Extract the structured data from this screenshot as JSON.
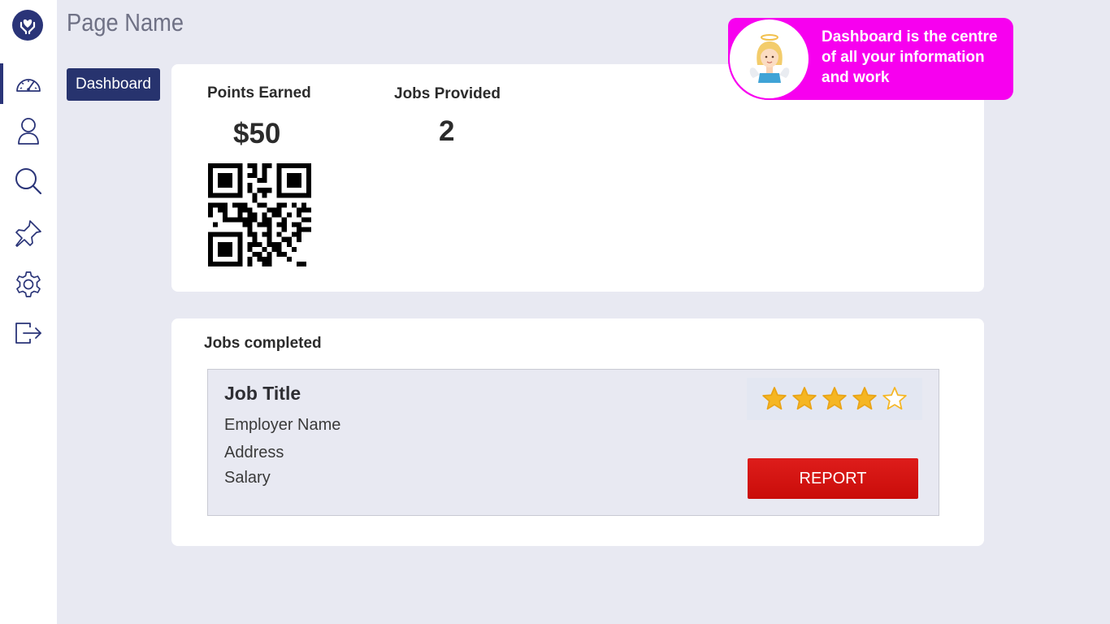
{
  "header": {
    "page_title": "Page Name"
  },
  "breadcrumb": {
    "label": "Dashboard"
  },
  "sidebar": {
    "items": [
      {
        "icon": "dashboard-gauge-icon",
        "active": true
      },
      {
        "icon": "profile-icon",
        "active": false
      },
      {
        "icon": "search-icon",
        "active": false
      },
      {
        "icon": "pin-icon",
        "active": false
      },
      {
        "icon": "settings-gear-icon",
        "active": false
      },
      {
        "icon": "logout-icon",
        "active": false
      }
    ]
  },
  "stats": {
    "points_label": "Points Earned",
    "points_value": "$50",
    "jobs_label": "Jobs Provided",
    "jobs_value": "2"
  },
  "jobs_completed": {
    "title": "Jobs completed",
    "items": [
      {
        "title": "Job Title",
        "employer": "Employer Name",
        "address": "Address",
        "salary": "Salary",
        "rating": 4,
        "rating_max": 5,
        "report_label": "REPORT"
      }
    ]
  },
  "tooltip": {
    "text": "Dashboard is the centre of all your information and work"
  },
  "colors": {
    "brand": "#2a3478",
    "tooltip": "#f700ef",
    "report": "#d10f0d",
    "star": "#f5b623"
  }
}
